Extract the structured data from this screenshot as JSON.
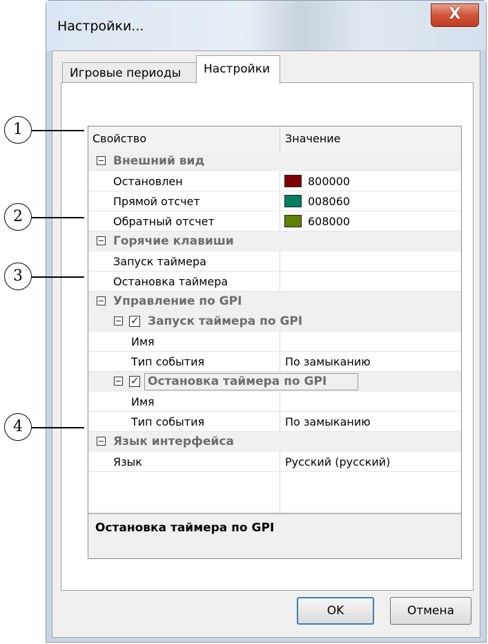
{
  "window": {
    "title": "Настройки...",
    "close_glyph": "X"
  },
  "tabs": [
    {
      "label": "Игровые периоды",
      "active": false
    },
    {
      "label": "Настройки",
      "active": true
    }
  ],
  "grid": {
    "headers": {
      "property": "Свойство",
      "value": "Значение"
    },
    "categories": {
      "appearance": {
        "label": "Внешний вид",
        "items": [
          {
            "label": "Остановлен",
            "value": "800000",
            "color": "#800000"
          },
          {
            "label": "Прямой отсчет",
            "value": "008060",
            "color": "#008060"
          },
          {
            "label": "Обратный отсчет",
            "value": "608000",
            "color": "#608000"
          }
        ]
      },
      "hotkeys": {
        "label": "Горячие клавиши",
        "items": [
          {
            "label": "Запуск таймера",
            "value": ""
          },
          {
            "label": "Остановка таймера",
            "value": ""
          }
        ]
      },
      "gpi": {
        "label": "Управление по GPI",
        "start": {
          "label": "Запуск таймера по GPI",
          "checked": true,
          "name_label": "Имя",
          "name_value": "",
          "event_label": "Тип события",
          "event_value": "По замыканию"
        },
        "stop": {
          "label": "Остановка таймера по GPI",
          "checked": true,
          "name_label": "Имя",
          "name_value": "",
          "event_label": "Тип события",
          "event_value": "По замыканию"
        }
      },
      "language": {
        "label": "Язык интерфейса",
        "items": [
          {
            "label": "Язык",
            "value": "Русский (русский)"
          }
        ]
      }
    },
    "description_title": "Остановка таймера по GPI"
  },
  "buttons": {
    "ok": "OK",
    "cancel": "Отмена"
  },
  "callouts": [
    "1",
    "2",
    "3",
    "4"
  ]
}
